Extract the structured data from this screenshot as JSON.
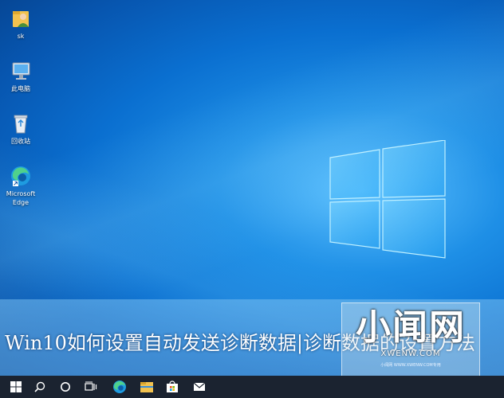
{
  "desktop": {
    "icons": [
      {
        "label": "sk",
        "icon": "user-folder-icon"
      },
      {
        "label": "此电脑",
        "icon": "this-pc-icon"
      },
      {
        "label": "回收站",
        "icon": "recycle-bin-icon"
      },
      {
        "label": "Microsoft\nEdge",
        "icon": "edge-icon"
      }
    ]
  },
  "banner": {
    "text": "Win10如何设置自动发送诊断数据|诊断数据的设置方法"
  },
  "watermark": {
    "title": "小闻网",
    "domain": "XWENW.COM",
    "small": "小闻网 WWW.XWENW.COM专用"
  },
  "taskbar": {
    "items": [
      "windows-start-icon",
      "search-icon",
      "cortana-icon",
      "task-view-icon",
      "edge-icon",
      "file-explorer-icon",
      "store-icon",
      "mail-icon"
    ]
  },
  "colors": {
    "desktop_blue": "#0a6fd0",
    "taskbar": "#1b2330"
  }
}
